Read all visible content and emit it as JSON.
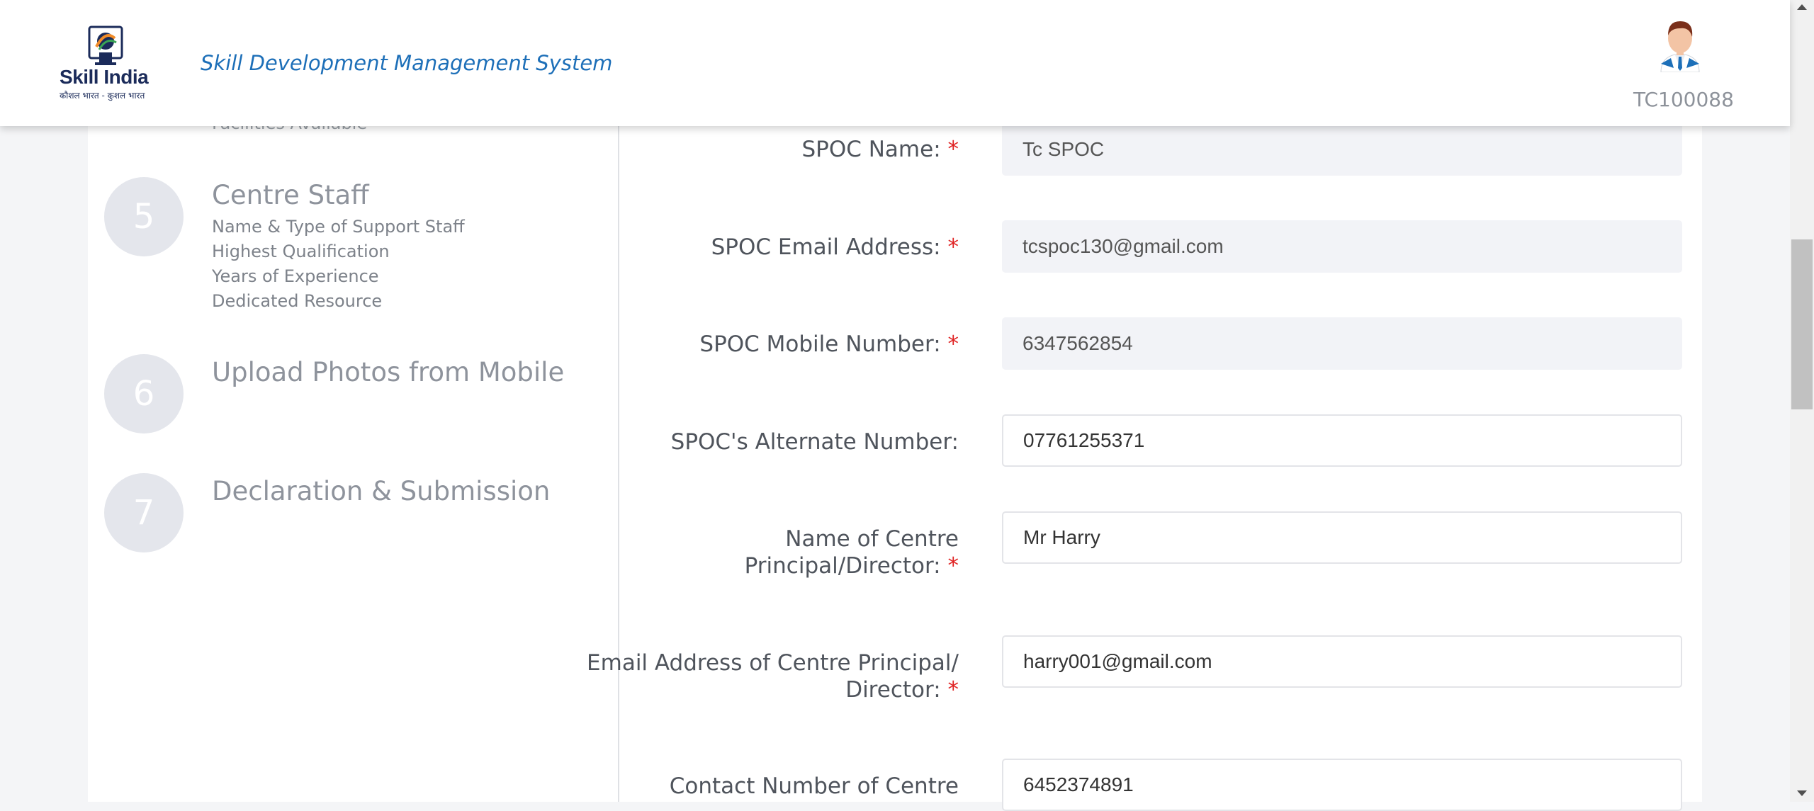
{
  "header": {
    "logo_text": "Skill India",
    "logo_tagline": "कौशल भारत - कुशल भारत",
    "app_title": "Skill Development Management System",
    "user_id": "TC100088"
  },
  "steps": {
    "cut_off_text": "Facilities Available",
    "items": [
      {
        "number": "5",
        "title": "Centre Staff",
        "sub": [
          "Name & Type of Support Staff",
          "Highest Qualification",
          "Years of Experience",
          "Dedicated Resource"
        ]
      },
      {
        "number": "6",
        "title": "Upload Photos from Mobile"
      },
      {
        "number": "7",
        "title": "Declaration & Submission"
      }
    ]
  },
  "form": {
    "spoc_name": {
      "label": "SPOC Name:",
      "required": "*",
      "value": "Tc SPOC"
    },
    "spoc_email": {
      "label": "SPOC Email Address:",
      "required": "*",
      "value": "tcspoc130@gmail.com"
    },
    "spoc_mobile": {
      "label": "SPOC Mobile Number:",
      "required": "*",
      "value": "6347562854"
    },
    "spoc_alternate": {
      "label": "SPOC's Alternate Number:",
      "value": "07761255371"
    },
    "principal_name": {
      "label_line1": "Name of Centre",
      "label_line2": "Principal/Director:",
      "required": "*",
      "value": "Mr Harry"
    },
    "principal_email": {
      "label_line1": "Email Address of Centre Principal/",
      "label_line2": "Director:",
      "required": "*",
      "value": "harry001@gmail.com"
    },
    "principal_contact": {
      "label_line1": "Contact Number of Centre",
      "value": "6452374891"
    }
  },
  "colors": {
    "accent": "#1d6fb8",
    "required": "#e02424",
    "step_circle": "#e4e6ec"
  }
}
